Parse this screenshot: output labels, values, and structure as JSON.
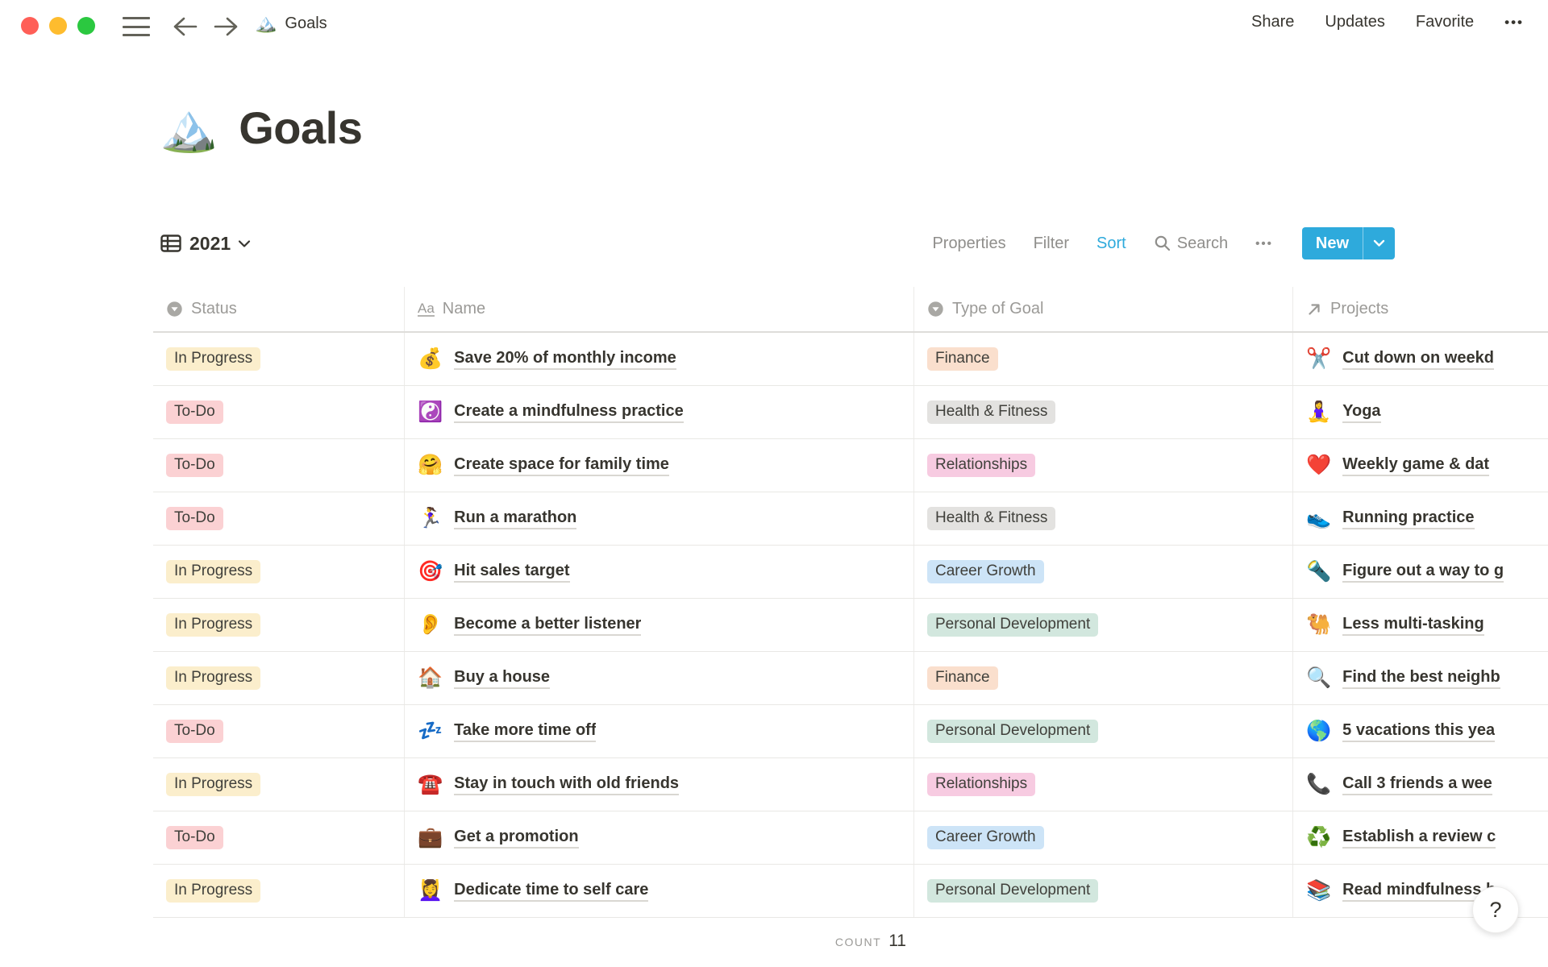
{
  "topbar": {
    "breadcrumb": {
      "icon": "🏔️",
      "label": "Goals"
    },
    "actions": {
      "share": "Share",
      "updates": "Updates",
      "favorite": "Favorite",
      "more": "•••"
    }
  },
  "page": {
    "icon": "🏔️",
    "title": "Goals"
  },
  "toolbar": {
    "view": {
      "label": "2021"
    },
    "properties": "Properties",
    "filter": "Filter",
    "sort": "Sort",
    "search": "Search",
    "more": "•••",
    "new_label": "New"
  },
  "table": {
    "columns": {
      "status": "Status",
      "name": "Name",
      "type": "Type of Goal",
      "projects": "Projects"
    },
    "rows": [
      {
        "status": "In Progress",
        "icon": "💰",
        "name": "Save 20% of monthly income",
        "type": "Finance",
        "project_icon": "✂️",
        "project": "Cut down on weekd"
      },
      {
        "status": "To-Do",
        "icon": "☯️",
        "name": "Create a mindfulness practice",
        "type": "Health & Fitness",
        "project_icon": "🧘‍♀️",
        "project": "Yoga"
      },
      {
        "status": "To-Do",
        "icon": "🤗",
        "name": "Create space for family time",
        "type": "Relationships",
        "project_icon": "❤️",
        "project": "Weekly game & dat"
      },
      {
        "status": "To-Do",
        "icon": "🏃‍♀️",
        "name": "Run a marathon",
        "type": "Health & Fitness",
        "project_icon": "👟",
        "project": "Running practice"
      },
      {
        "status": "In Progress",
        "icon": "🎯",
        "name": "Hit sales target",
        "type": "Career Growth",
        "project_icon": "🔦",
        "project": "Figure out a way to g"
      },
      {
        "status": "In Progress",
        "icon": "👂",
        "name": "Become a better listener",
        "type": "Personal Development",
        "project_icon": "🐫",
        "project": "Less multi-tasking"
      },
      {
        "status": "In Progress",
        "icon": "🏠",
        "name": "Buy a house",
        "type": "Finance",
        "project_icon": "🔍",
        "project": "Find the best neighb"
      },
      {
        "status": "To-Do",
        "icon": "💤",
        "name": "Take more time off",
        "type": "Personal Development",
        "project_icon": "🌎",
        "project": "5 vacations this yea"
      },
      {
        "status": "In Progress",
        "icon": "☎️",
        "name": "Stay in touch with old friends",
        "type": "Relationships",
        "project_icon": "📞",
        "project": "Call 3 friends a wee"
      },
      {
        "status": "To-Do",
        "icon": "💼",
        "name": "Get a promotion",
        "type": "Career Growth",
        "project_icon": "♻️",
        "project": "Establish a review c"
      },
      {
        "status": "In Progress",
        "icon": "💆‍♀️",
        "name": "Dedicate time to self care",
        "type": "Personal Development",
        "project_icon": "📚",
        "project": "Read mindfulness b"
      }
    ],
    "footer": {
      "count_label": "COUNT",
      "count_value": "11"
    }
  },
  "help": {
    "label": "?"
  },
  "colors": {
    "accent": "#2EAADC",
    "status": {
      "In Progress": "#FBEECC",
      "To-Do": "#FBD1D3"
    },
    "type": {
      "Finance": "#FADFCD",
      "Health & Fitness": "#E3E2E0",
      "Relationships": "#F7CBE1",
      "Career Growth": "#CDE4F7",
      "Personal Development": "#D2E7DE"
    }
  }
}
